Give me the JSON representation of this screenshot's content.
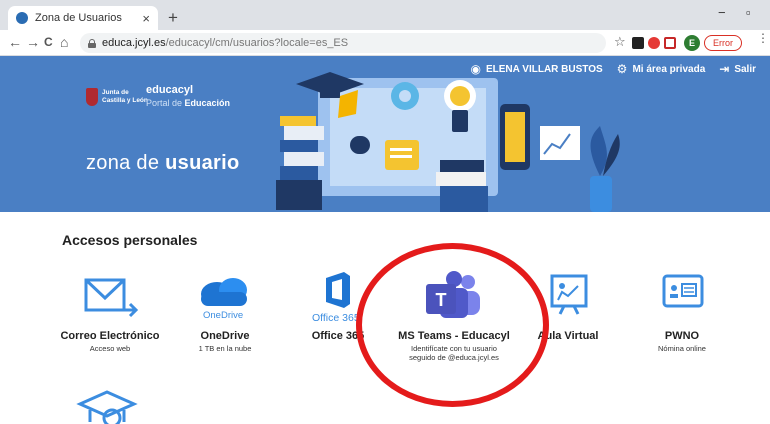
{
  "browser": {
    "tab_title": "Zona de Usuarios",
    "tab_close": "×",
    "new_tab": "+",
    "minimize": "−",
    "restore": "▫",
    "back": "←",
    "forward": "→",
    "reload": "C",
    "home": "⌂",
    "url_host": "educa.jcyl.es",
    "url_path": "/educacyl/cm/usuarios?locale=es_ES",
    "star": "☆",
    "profile_initial": "E",
    "profile_status": "Error",
    "menu": "⋮"
  },
  "header": {
    "user_name": "ELENA VILLAR BUSTOS",
    "private_area": "Mi área privada",
    "logout": "Salir",
    "org_line1": "Junta de",
    "org_line2": "Castilla y León",
    "portal_name": "educacyl",
    "portal_sub_prefix": "Portal de",
    "portal_sub_bold": "Educación",
    "zone_prefix": "zona de",
    "zone_bold": "usuario"
  },
  "section": {
    "title": "Accesos personales"
  },
  "cards": [
    {
      "label": "Correo Electrónico",
      "sub": "Acceso web",
      "icon": "mail-icon"
    },
    {
      "label": "OneDrive",
      "sub": "1 TB en la nube",
      "brand": "OneDrive",
      "icon": "onedrive-icon"
    },
    {
      "label": "Office 365",
      "sub": "",
      "brand": "Office 365",
      "icon": "office-icon"
    },
    {
      "label": "MS Teams - Educacyl",
      "sub1": "Identifícate con tu usuario",
      "sub2": "seguido de @educa.jcyl.es",
      "icon": "teams-icon"
    },
    {
      "label": "Aula Virtual",
      "sub": "",
      "icon": "virtual-classroom-icon"
    },
    {
      "label": "PWNO",
      "sub": "Nómina online",
      "icon": "payroll-icon"
    }
  ],
  "colors": {
    "banner": "#4a7fc4",
    "accent": "#3c8de0",
    "highlight_ring": "#e41b1b",
    "teams": "#5059c9"
  }
}
